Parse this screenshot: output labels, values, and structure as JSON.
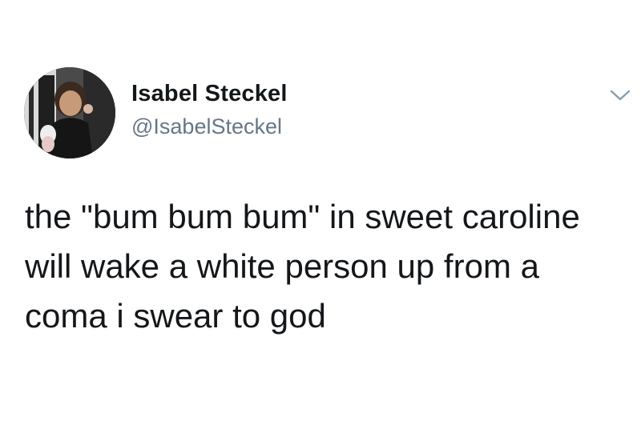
{
  "tweet": {
    "author": {
      "display_name": "Isabel Steckel",
      "handle": "@IsabelSteckel"
    },
    "text_lines": [
      "the \"bum bum bum\" in sweet caroline",
      "will wake a white person up from a",
      "coma i swear to god"
    ],
    "icons": {
      "avatar": "avatar-photo",
      "menu": "chevron-down-icon"
    },
    "colors": {
      "text": "#14171a",
      "secondary_text": "#657786",
      "background": "#ffffff"
    }
  }
}
